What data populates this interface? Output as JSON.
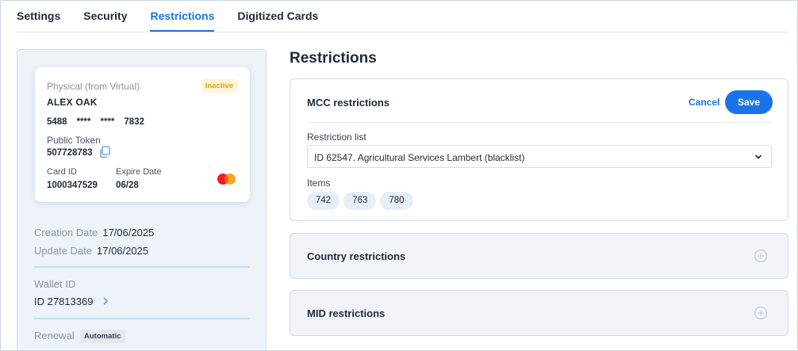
{
  "tabs": [
    {
      "label": "Settings",
      "active": false
    },
    {
      "label": "Security",
      "active": false
    },
    {
      "label": "Restrictions",
      "active": true
    },
    {
      "label": "Digitized Cards",
      "active": false
    }
  ],
  "card": {
    "type_label": "Physical (from Virtual)",
    "status_badge": "Inactive",
    "holder": "ALEX OAK",
    "pan_parts": [
      "5488",
      "****",
      "****",
      "7832"
    ],
    "public_token_label": "Public Token",
    "public_token_value": "507728783",
    "card_id_label": "Card ID",
    "card_id_value": "1000347529",
    "expire_label": "Expire Date",
    "expire_value": "06/28",
    "network_icon": "mastercard-icon"
  },
  "details": {
    "creation_label": "Creation Date",
    "creation_value": "17/06/2025",
    "update_label": "Update Date",
    "update_value": "17/06/2025",
    "wallet_label": "Wallet ID",
    "wallet_value": "ID 27813369",
    "renewal_label": "Renewal",
    "renewal_value": "Automatic"
  },
  "main": {
    "title": "Restrictions",
    "mcc": {
      "title": "MCC restrictions",
      "cancel_label": "Cancel",
      "save_label": "Save",
      "list_label": "Restriction list",
      "list_value": "ID 62547. Agricultural Services Lambert (blacklist)",
      "items_label": "Items",
      "items": [
        "742",
        "763",
        "780"
      ]
    },
    "country": {
      "title": "Country restrictions"
    },
    "mid": {
      "title": "MID restrictions"
    }
  },
  "colors": {
    "accent": "#1a73e8",
    "inactive_badge_text": "#e0a312",
    "inactive_badge_bg": "#fff5d9",
    "panel_bg": "#eef3fa",
    "collapsed_bg": "#f1f5fa",
    "chip_bg": "#e7eef8"
  }
}
